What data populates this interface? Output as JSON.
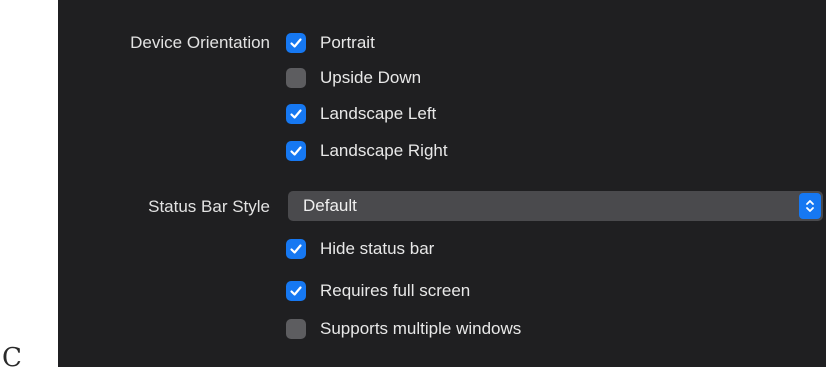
{
  "stray_text": "C",
  "device_orientation": {
    "label": "Device Orientation",
    "options": [
      {
        "label": "Portrait",
        "checked": true
      },
      {
        "label": "Upside Down",
        "checked": false
      },
      {
        "label": "Landscape Left",
        "checked": true
      },
      {
        "label": "Landscape Right",
        "checked": true
      }
    ]
  },
  "status_bar_style": {
    "label": "Status Bar Style",
    "selected": "Default"
  },
  "options": [
    {
      "label": "Hide status bar",
      "checked": true
    },
    {
      "label": "Requires full screen",
      "checked": true
    },
    {
      "label": "Supports multiple windows",
      "checked": false
    }
  ],
  "colors": {
    "accent": "#1678f2",
    "panel_background": "#1f1f21",
    "unchecked_box": "#5d5d60",
    "popup_background": "#4a4a4d"
  }
}
